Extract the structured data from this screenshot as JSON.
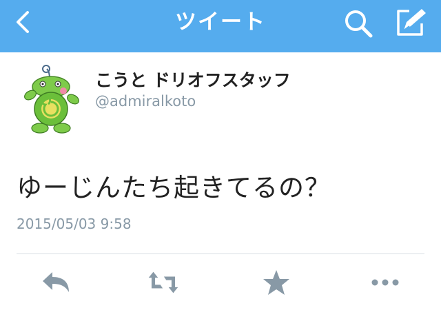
{
  "navbar": {
    "title": "ツイート",
    "back_icon": "chevron-left-icon",
    "search_icon": "search-icon",
    "compose_icon": "compose-icon",
    "color": "#55acee"
  },
  "tweet": {
    "display_name": "こうと ドリオフスタッフ",
    "handle": "@admiralkoto",
    "text": "ゆーじんたち起きてるの？",
    "timestamp": "2015/05/03 9:58",
    "avatar_icon": "frog-creature-avatar"
  },
  "actions": [
    {
      "icon": "reply-icon"
    },
    {
      "icon": "retweet-icon"
    },
    {
      "icon": "favorite-star-icon"
    },
    {
      "icon": "more-icon"
    }
  ],
  "colors": {
    "secondary_text": "#8899a6",
    "action_icon": "#8899a6"
  }
}
